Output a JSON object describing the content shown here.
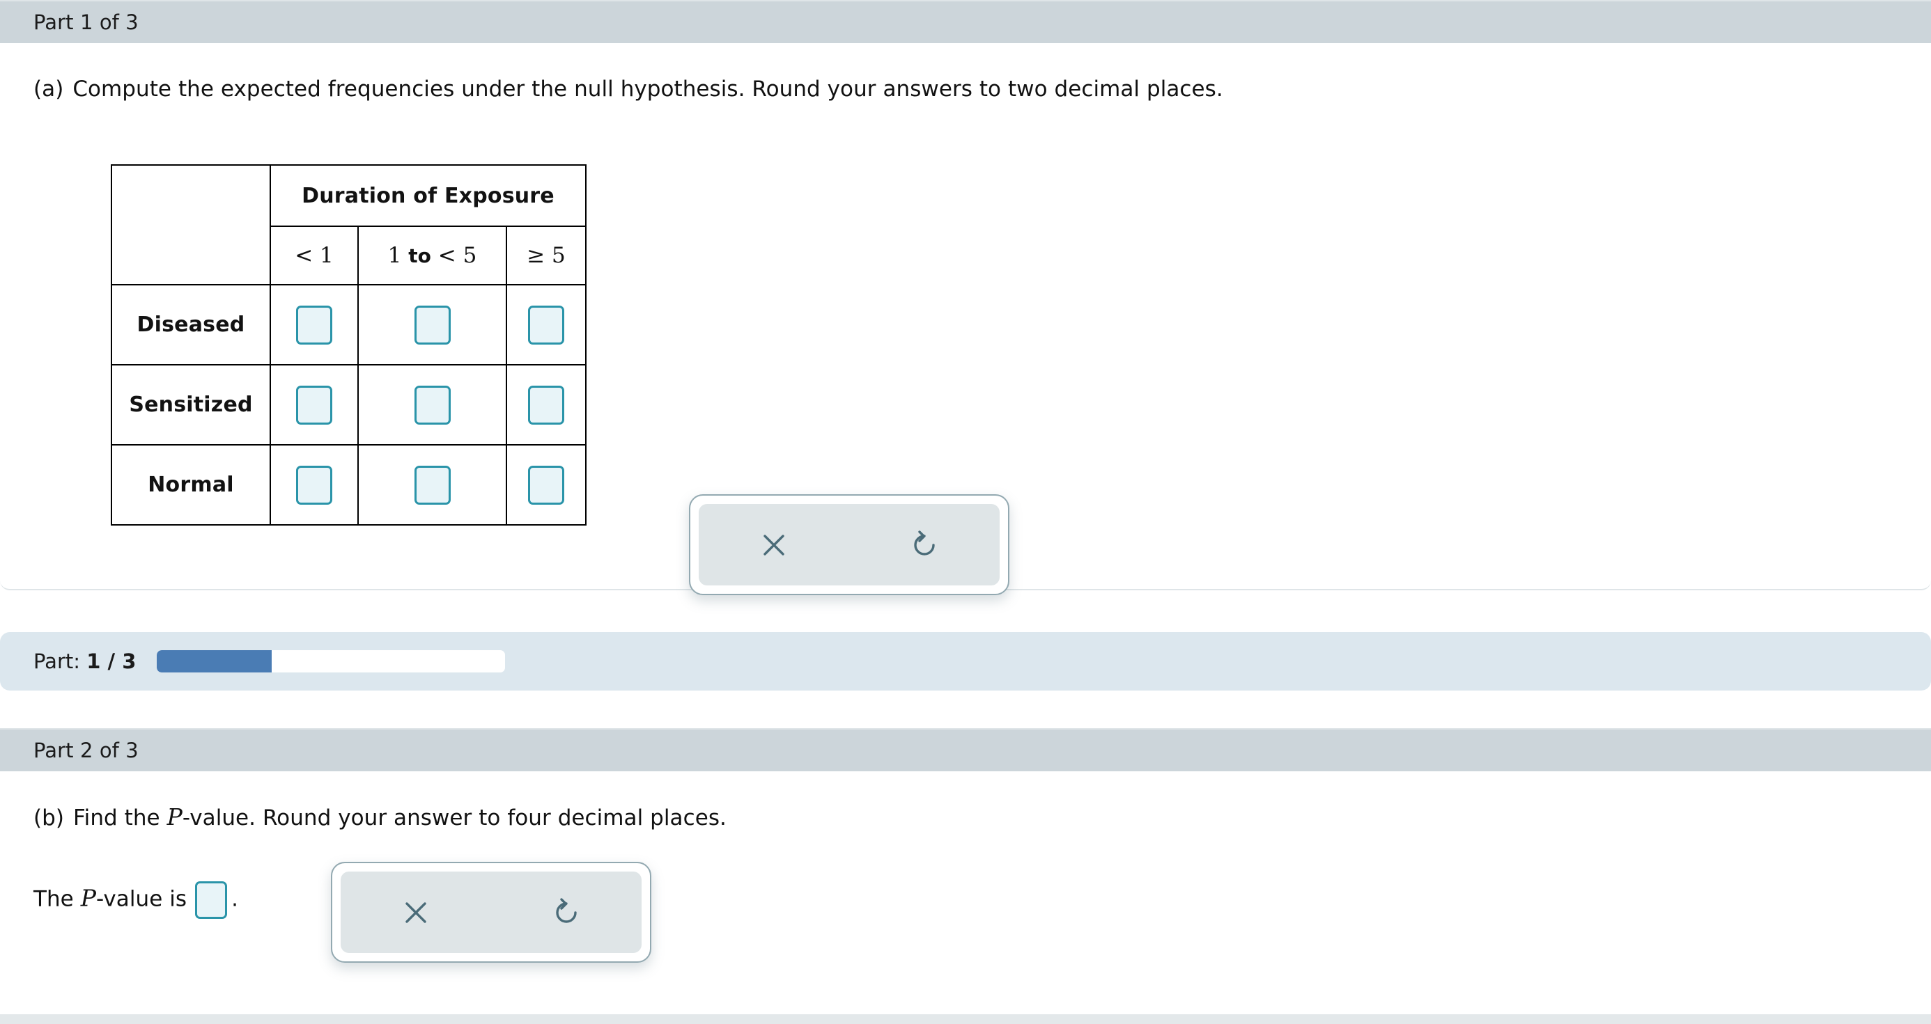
{
  "colors": {
    "header_bar": "#ccd5da",
    "progress_band": "#dce7ee",
    "progress_fill": "#4a7cb4",
    "input_border": "#2a94a9",
    "input_fill": "#e8f4f8",
    "tool_icon": "#4a6b78"
  },
  "part1": {
    "header": "Part 1 of 3",
    "question": {
      "tag": "(a)",
      "text": "Compute the expected frequencies under the null hypothesis. Round your answers to two decimal places."
    },
    "table": {
      "group_header": "Duration of Exposure",
      "column_headers": [
        "< 1",
        "1 to < 5",
        "≥ 5"
      ],
      "column_header_parts": {
        "c0": {
          "pre": "< 1"
        },
        "c1": {
          "left": "1",
          "keyword": "to",
          "right": "< 5"
        },
        "c2": {
          "pre": "≥ 5"
        }
      },
      "row_headers": [
        "Diseased",
        "Sensitized",
        "Normal"
      ],
      "cells": [
        [
          "",
          "",
          ""
        ],
        [
          "",
          "",
          ""
        ],
        [
          "",
          "",
          ""
        ]
      ]
    },
    "tools": {
      "clear_label": "clear",
      "undo_label": "undo"
    }
  },
  "progress": {
    "label_prefix": "Part:",
    "label_value": "1 / 3",
    "current": 1,
    "total": 3,
    "percent": 33
  },
  "part2": {
    "header": "Part 2 of 3",
    "question": {
      "tag": "(b)",
      "before_P": "Find the ",
      "P": "P",
      "after_P": "-value. Round your answer to four decimal places."
    },
    "answer_line": {
      "before_P": "The ",
      "P": "P",
      "after_P": "-value is",
      "value": "",
      "terminator": "."
    },
    "tools": {
      "clear_label": "clear",
      "undo_label": "undo"
    }
  }
}
